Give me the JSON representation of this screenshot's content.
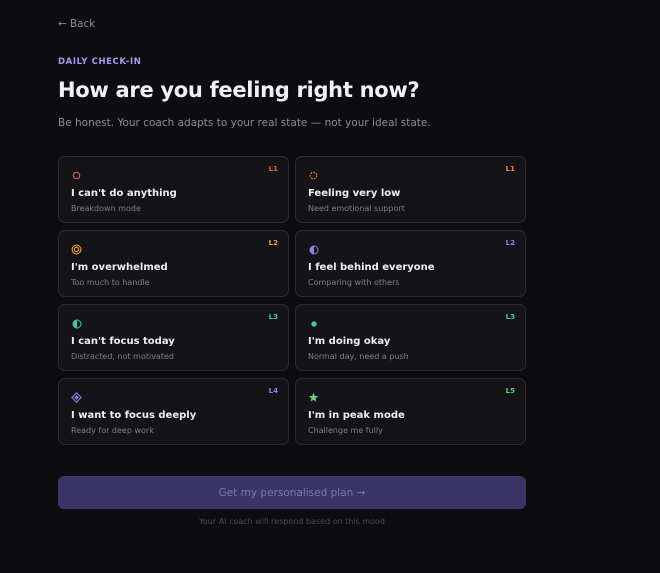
{
  "nav": {
    "back_arrow": "←",
    "back_label": "Back"
  },
  "header": {
    "eyebrow": "DAILY CHECK-IN",
    "title": "How are you feeling right now?",
    "subtitle": "Be honest. Your coach adapts to your real state — not your ideal state."
  },
  "moods": [
    {
      "id": "cant-do-anything",
      "label": "I can't do anything",
      "desc": "Breakdown mode",
      "level": "L1",
      "icon": "ring-icon",
      "color": "#e2673f"
    },
    {
      "id": "feeling-very-low",
      "label": "Feeling very low",
      "desc": "Need emotional support",
      "level": "L1",
      "icon": "dashed-ring-icon",
      "color": "#e58a4f"
    },
    {
      "id": "overwhelmed",
      "label": "I'm overwhelmed",
      "desc": "Too much to handle",
      "level": "L2",
      "icon": "double-ring-icon",
      "color": "#e8a13c"
    },
    {
      "id": "behind-everyone",
      "label": "I feel behind everyone",
      "desc": "Comparing with others",
      "level": "L2",
      "icon": "half-circle-icon",
      "color": "#8a82ee"
    },
    {
      "id": "cant-focus",
      "label": "I can't focus today",
      "desc": "Distracted, not motivated",
      "level": "L3",
      "icon": "half-circle-icon",
      "color": "#3ec9a0"
    },
    {
      "id": "doing-okay",
      "label": "I'm doing okay",
      "desc": "Normal day, need a push",
      "level": "L3",
      "icon": "dot-icon",
      "color": "#3ec9a0"
    },
    {
      "id": "focus-deeply",
      "label": "I want to focus deeply",
      "desc": "Ready for deep work",
      "level": "L4",
      "icon": "diamond-icon",
      "color": "#8a82ee"
    },
    {
      "id": "peak-mode",
      "label": "I'm in peak mode",
      "desc": "Challenge me fully",
      "level": "L5",
      "icon": "star-icon",
      "color": "#5fd07a"
    }
  ],
  "cta": {
    "label": "Get my personalised plan →"
  },
  "footnote": "Your AI coach will respond based on this mood",
  "colors": {
    "background": "#0d0d10",
    "card_bg": "#141418",
    "card_border": "#2a2a31",
    "accent": "#a29bf5",
    "cta_bg": "#3b3466"
  }
}
